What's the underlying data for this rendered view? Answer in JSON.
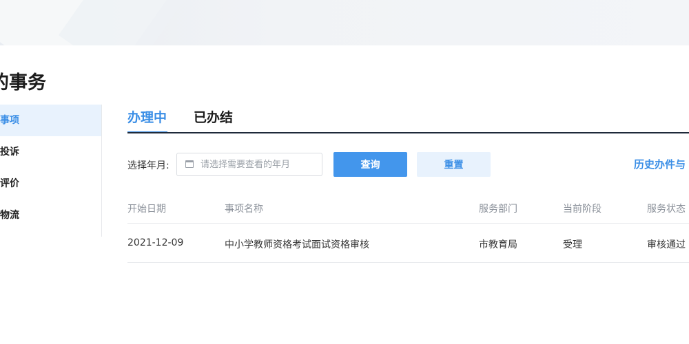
{
  "page": {
    "title": "的事务"
  },
  "sidebar": {
    "items": [
      {
        "label": "的事项",
        "active": true
      },
      {
        "label": "询投诉",
        "active": false
      },
      {
        "label": "的评价",
        "active": false
      },
      {
        "label": "的物流",
        "active": false
      }
    ]
  },
  "tabs": [
    {
      "label": "办理中",
      "active": true
    },
    {
      "label": "已办结",
      "active": false
    }
  ],
  "filter": {
    "label": "选择年月:",
    "input_value": "",
    "placeholder": "请选择需要查看的年月",
    "query_label": "查询",
    "reset_label": "重置",
    "history_link": "历史办件与"
  },
  "table": {
    "columns": [
      "开始日期",
      "事项名称",
      "服务部门",
      "当前阶段",
      "服务状态"
    ],
    "rows": [
      [
        "2021-12-09",
        "中小学教师资格考试面试资格审核",
        "市教育局",
        "受理",
        "审核通过"
      ]
    ]
  },
  "colors": {
    "accent": "#3a8ee6",
    "button": "#4396ec",
    "active_bg": "#e8f2fd"
  },
  "icons": {
    "date_input": "calendar-icon"
  }
}
